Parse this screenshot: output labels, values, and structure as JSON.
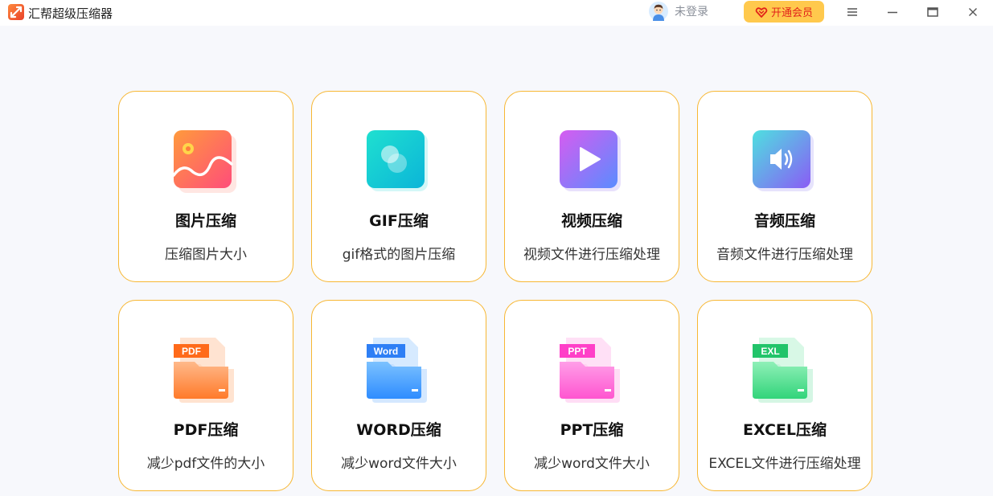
{
  "app": {
    "title": "汇帮超级压缩器"
  },
  "header": {
    "login_text": "未登录",
    "vip_label": "开通会员"
  },
  "colors": {
    "card_border": "#f7b733",
    "vip_bg": "#ffc94d",
    "vip_text": "#e2231a"
  },
  "cards": [
    {
      "title": "图片压缩",
      "desc": "压缩图片大小",
      "icon": "image-icon"
    },
    {
      "title": "GIF压缩",
      "desc": "gif格式的图片压缩",
      "icon": "gif-icon"
    },
    {
      "title": "视频压缩",
      "desc": "视频文件进行压缩处理",
      "icon": "video-play-icon"
    },
    {
      "title": "音频压缩",
      "desc": "音频文件进行压缩处理",
      "icon": "audio-speaker-icon"
    },
    {
      "title": "PDF压缩",
      "desc": "减少pdf文件的大小",
      "icon": "pdf-file-icon",
      "badge": "PDF"
    },
    {
      "title": "WORD压缩",
      "desc": "减少word文件大小",
      "icon": "word-file-icon",
      "badge": "Word"
    },
    {
      "title": "PPT压缩",
      "desc": "减少word文件大小",
      "icon": "ppt-file-icon",
      "badge": "PPT"
    },
    {
      "title": "EXCEL压缩",
      "desc": "EXCEL文件进行压缩处理",
      "icon": "excel-file-icon",
      "badge": "EXL"
    }
  ]
}
